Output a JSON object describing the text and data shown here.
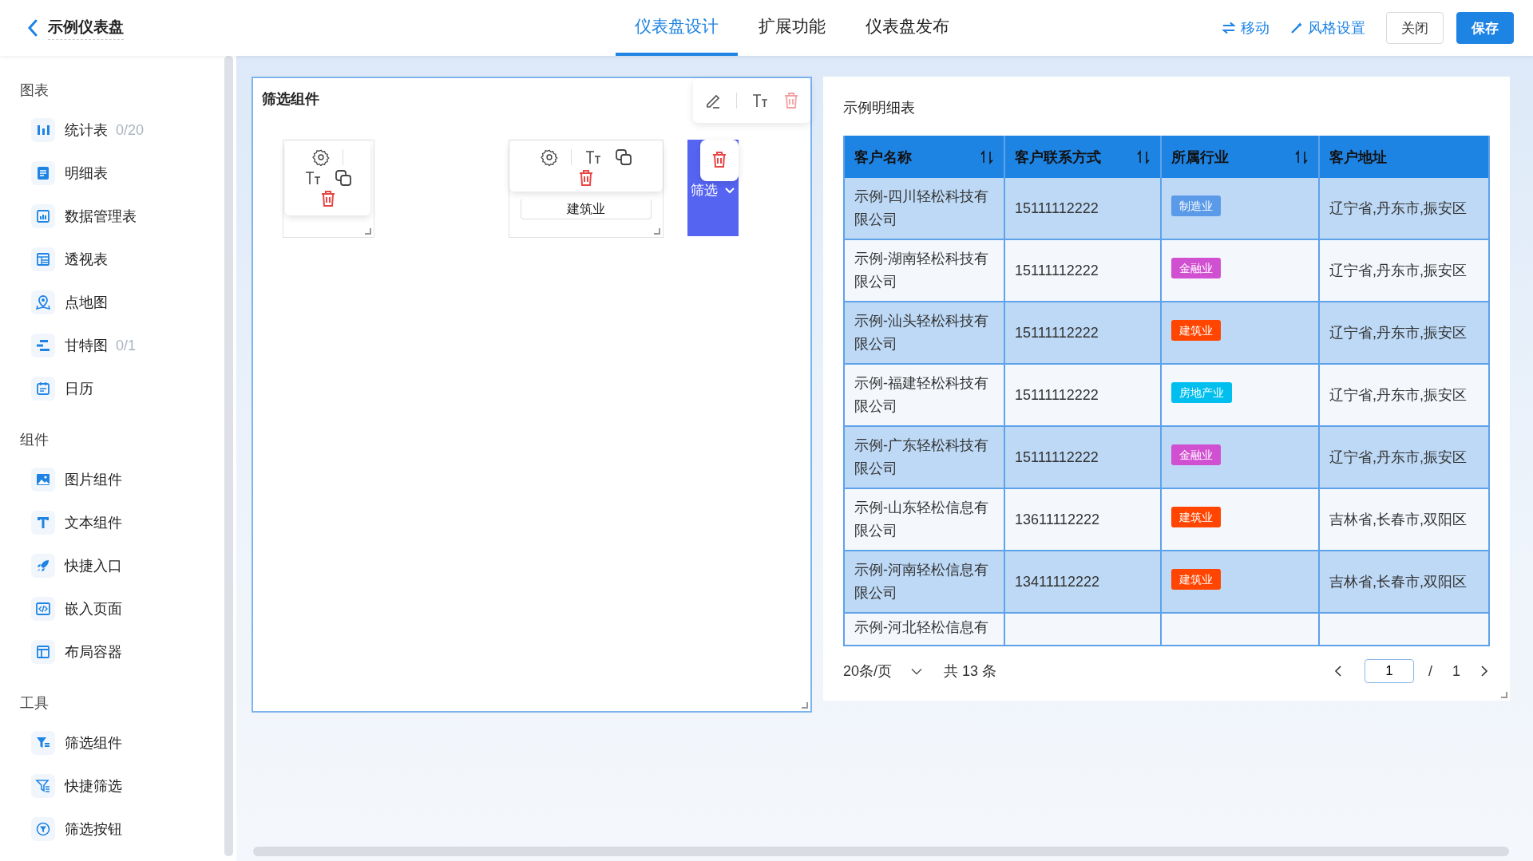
{
  "header": {
    "back_label": "示例仪表盘",
    "tabs": [
      {
        "label": "仪表盘设计",
        "selected": true
      },
      {
        "label": "扩展功能",
        "selected": false
      },
      {
        "label": "仪表盘发布",
        "selected": false
      }
    ],
    "links": [
      "移动",
      "风格设置"
    ],
    "buttons": [
      {
        "label": "关闭",
        "kind": "default"
      },
      {
        "label": "保存",
        "kind": "primary"
      }
    ]
  },
  "sidebar": {
    "sections": [
      {
        "title": "图表",
        "items": [
          {
            "label": "统计表",
            "count": "0/20"
          },
          {
            "label": "明细表"
          },
          {
            "label": "数据管理表"
          },
          {
            "label": "透视表"
          },
          {
            "label": "点地图"
          },
          {
            "label": "甘特图",
            "count": "0/1"
          },
          {
            "label": "日历"
          }
        ]
      },
      {
        "title": "组件",
        "items": [
          {
            "label": "图片组件"
          },
          {
            "label": "文本组件"
          },
          {
            "label": "快捷入口"
          },
          {
            "label": "嵌入页面"
          },
          {
            "label": "布局容器"
          }
        ]
      },
      {
        "title": "工具",
        "items": [
          {
            "label": "筛选组件"
          },
          {
            "label": "快捷筛选"
          },
          {
            "label": "筛选按钮"
          }
        ]
      }
    ]
  },
  "filter_panel": {
    "title": "筛选组件",
    "widgets": [
      {
        "kind": "blank"
      },
      {
        "kind": "select",
        "value": "建筑业"
      },
      {
        "kind": "button",
        "label": "筛选"
      }
    ]
  },
  "table_card": {
    "title": "示例明细表",
    "columns": [
      {
        "label": "客户名称",
        "sortable": true
      },
      {
        "label": "客户联系方式",
        "sortable": true
      },
      {
        "label": "所属行业",
        "sortable": true
      },
      {
        "label": "客户地址",
        "sortable": false
      }
    ],
    "rows": [
      {
        "name": "示例-四川轻松科技有限公司",
        "phone": "15111112222",
        "industry": "制造业",
        "color": "#5b9ae8",
        "address": "辽宁省,丹东市,振安区"
      },
      {
        "name": "示例-湖南轻松科技有限公司",
        "phone": "15111112222",
        "industry": "金融业",
        "color": "#d150d1",
        "address": "辽宁省,丹东市,振安区"
      },
      {
        "name": "示例-汕头轻松科技有限公司",
        "phone": "15111112222",
        "industry": "建筑业",
        "color": "#ff4500",
        "address": "辽宁省,丹东市,振安区"
      },
      {
        "name": "示例-福建轻松科技有限公司",
        "phone": "15111112222",
        "industry": "房地产业",
        "color": "#00bfef",
        "address": "辽宁省,丹东市,振安区"
      },
      {
        "name": "示例-广东轻松科技有限公司",
        "phone": "15111112222",
        "industry": "金融业",
        "color": "#d150d1",
        "address": "辽宁省,丹东市,振安区"
      },
      {
        "name": "示例-山东轻松信息有限公司",
        "phone": "13611112222",
        "industry": "建筑业",
        "color": "#ff4500",
        "address": "吉林省,长春市,双阳区"
      },
      {
        "name": "示例-河南轻松信息有限公司",
        "phone": "13411112222",
        "industry": "建筑业",
        "color": "#ff4500",
        "address": "吉林省,长春市,双阳区"
      },
      {
        "name": "示例-河北轻松信息有"
      }
    ],
    "pagination": {
      "page_size": "20条/页",
      "total": "共 13 条",
      "page": "1",
      "separator": "/",
      "pages": "1"
    }
  }
}
